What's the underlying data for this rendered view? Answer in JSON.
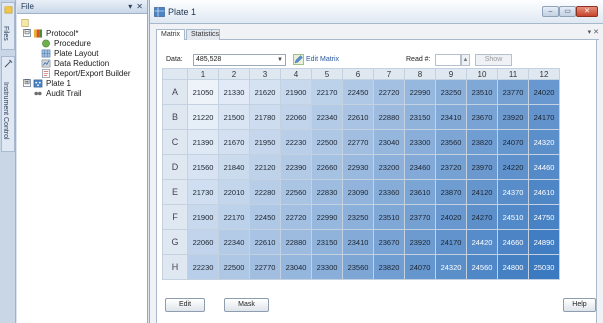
{
  "left_strip": {
    "tabs": [
      "Files",
      "Instrument Control"
    ]
  },
  "file_pane": {
    "title": "File",
    "pin_label": "▾",
    "close_label": "✕",
    "tree": [
      {
        "label": "Protocol*",
        "icon": "protocol-icon",
        "depth": 1,
        "expander": "⊟"
      },
      {
        "label": "Procedure",
        "icon": "procedure-icon",
        "depth": 2
      },
      {
        "label": "Plate Layout",
        "icon": "plate-layout-icon",
        "depth": 2
      },
      {
        "label": "Data Reduction",
        "icon": "data-reduction-icon",
        "depth": 2
      },
      {
        "label": "Report/Export Builder",
        "icon": "report-icon",
        "depth": 2
      },
      {
        "label": "Plate 1",
        "icon": "plate-icon",
        "depth": 1,
        "expander": "⊞"
      },
      {
        "label": "Audit Trail",
        "icon": "audit-trail-icon",
        "depth": 1
      }
    ]
  },
  "plate_window": {
    "title": "Plate 1",
    "window_buttons": {
      "minimize": "–",
      "restore": "▭",
      "close": "✕"
    },
    "tabs": [
      "Matrix",
      "Statistics"
    ],
    "tab_extra": "▾ ✕",
    "data_label": "Data:",
    "data_value": "485,528",
    "edit_matrix_label": "Edit Matrix",
    "read_label": "Read #:",
    "show_label": "Show",
    "edit_button": "Edit",
    "mask_button": "Mask",
    "help_button": "Help",
    "columns": [
      "1",
      "2",
      "3",
      "4",
      "5",
      "6",
      "7",
      "8",
      "9",
      "10",
      "11",
      "12"
    ],
    "rows": [
      {
        "label": "A",
        "values": [
          "21050",
          "21330",
          "21620",
          "21900",
          "22170",
          "22450",
          "22720",
          "22990",
          "23250",
          "23510",
          "23770",
          "24020"
        ]
      },
      {
        "label": "B",
        "values": [
          "21220",
          "21500",
          "21780",
          "22060",
          "22340",
          "22610",
          "22880",
          "23150",
          "23410",
          "23670",
          "23920",
          "24170"
        ]
      },
      {
        "label": "C",
        "values": [
          "21390",
          "21670",
          "21950",
          "22230",
          "22500",
          "22770",
          "23040",
          "23300",
          "23560",
          "23820",
          "24070",
          "24320"
        ]
      },
      {
        "label": "D",
        "values": [
          "21560",
          "21840",
          "22120",
          "22390",
          "22660",
          "22930",
          "23200",
          "23460",
          "23720",
          "23970",
          "24220",
          "24460"
        ]
      },
      {
        "label": "E",
        "values": [
          "21730",
          "22010",
          "22280",
          "22560",
          "22830",
          "23090",
          "23360",
          "23610",
          "23870",
          "24120",
          "24370",
          "24610"
        ]
      },
      {
        "label": "F",
        "values": [
          "21900",
          "22170",
          "22450",
          "22720",
          "22990",
          "23250",
          "23510",
          "23770",
          "24020",
          "24270",
          "24510",
          "24750"
        ]
      },
      {
        "label": "G",
        "values": [
          "22060",
          "22340",
          "22610",
          "22880",
          "23150",
          "23410",
          "23670",
          "23920",
          "24170",
          "24420",
          "24660",
          "24890"
        ]
      },
      {
        "label": "H",
        "values": [
          "22230",
          "22500",
          "22770",
          "23040",
          "23300",
          "23560",
          "23820",
          "24070",
          "24320",
          "24560",
          "24800",
          "25030"
        ]
      }
    ]
  },
  "colors": {
    "heat_low": "#eef3fa",
    "heat_high": "#3b79c0",
    "accent": "#2a5aa0"
  }
}
